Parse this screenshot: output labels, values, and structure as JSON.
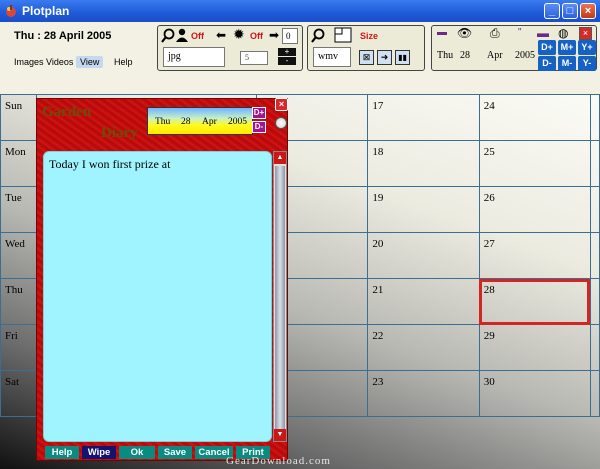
{
  "window": {
    "title": "Plotplan",
    "min": "_",
    "max": "□",
    "close": "×"
  },
  "header": {
    "date_text": "Thu : 28 April 2005",
    "menu": [
      {
        "label": "Images"
      },
      {
        "label": "Videos"
      },
      {
        "label": "View",
        "active": true
      },
      {
        "label": "Help"
      }
    ]
  },
  "toolbar": {
    "image_group": {
      "person_off": "Off",
      "gear_off": "Off",
      "image_ext": "jpg",
      "counter_top": "0",
      "counter_value": "5",
      "plus": "+",
      "minus": "-"
    },
    "video_group": {
      "size_label": "Size",
      "video_ext": "wmv"
    },
    "date_group": {
      "day": "Thu",
      "date": "28",
      "month": "Apr",
      "year": "2005",
      "buttons": [
        "D+",
        "M+",
        "Y+",
        "D-",
        "M-",
        "Y-"
      ]
    }
  },
  "calendar": {
    "days": [
      "Sun",
      "Mon",
      "Tue",
      "Wed",
      "Thu",
      "Fri",
      "Sat"
    ],
    "col3": [
      "17",
      "18",
      "19",
      "20",
      "21",
      "22",
      "23"
    ],
    "col4": [
      "24",
      "25",
      "26",
      "27",
      "28",
      "29",
      "30"
    ],
    "selected": "28",
    "selected_color": "#d42525"
  },
  "diary": {
    "title_line1": "Garden",
    "title_line2": "Diary",
    "day": "Thu",
    "date": "28",
    "month": "Apr",
    "year": "2005",
    "day_plus": "D+",
    "day_minus": "D-",
    "close": "×",
    "note_text": "Today I won first prize at",
    "scroll_up": "▲",
    "scroll_down": "▼",
    "buttons": [
      "Help",
      "Wipe",
      "Ok",
      "Save",
      "Cancel",
      "Print"
    ]
  },
  "watermark": "GearDownload.com",
  "colors": {
    "titlebar": "#1e5ad8",
    "off_red": "#d21414",
    "date_button_blue": "#1561c4",
    "diary_red": "#c80f0f",
    "note_cyan": "#a0f4ff"
  }
}
